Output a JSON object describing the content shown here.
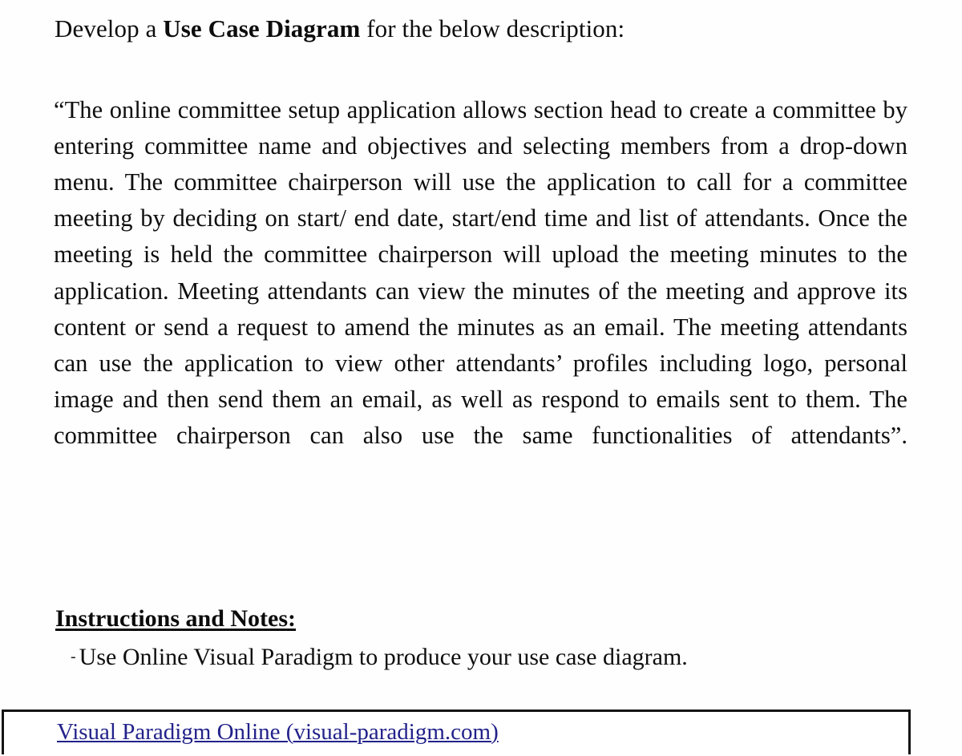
{
  "document": {
    "heading": {
      "prefix": "Develop a ",
      "bold": "Use Case Diagram",
      "suffix": " for the below description:"
    },
    "body_paragraph": "“The online committee setup application allows section head to create a committee by entering committee name and objectives and selecting members from a drop-down menu. The committee chairperson will use the application to call for a committee meeting by deciding on start/ end date, start/end time and list of attendants. Once the meeting is held the committee chairperson will upload the meeting minutes to the application. Meeting attendants can view the minutes of the meeting and approve its content or send a request to amend the minutes as an email. The meeting attendants can use the application to view other attendants’ profiles including logo, personal image and then send them an email, as well as respond to emails sent to them. The committee chairperson can also use the same functionalities of attendants”.",
    "instructions": {
      "heading": "Instructions and Notes:",
      "bullet_marker": "-",
      "items": [
        "Use Online Visual Paradigm to produce your use case diagram."
      ]
    },
    "link_box": {
      "link_text": "Visual Paradigm Online (visual-paradigm.com)",
      "link_color": "#22228B",
      "border_color": "#141414"
    }
  }
}
